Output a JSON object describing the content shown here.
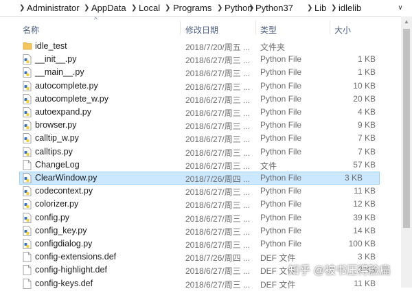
{
  "address_bar": {
    "crumbs": [
      "Administrator",
      "AppData",
      "Local",
      "Programs",
      "Python",
      "Python37",
      "Lib",
      "idlelib"
    ],
    "separator": "❯",
    "dropdown_glyph": "∨"
  },
  "columns": {
    "name": "名称",
    "date": "修改日期",
    "type": "类型",
    "size": "大小",
    "sort_glyph": "^"
  },
  "files": [
    {
      "name": "idle_test",
      "date": "2018/7/20/周五 ...",
      "type": "文件夹",
      "size": "",
      "icon": "folder-icon"
    },
    {
      "name": "__init__.py",
      "date": "2018/6/27/周三 ...",
      "type": "Python File",
      "size": "1 KB",
      "icon": "python-file-icon"
    },
    {
      "name": "__main__.py",
      "date": "2018/6/27/周三 ...",
      "type": "Python File",
      "size": "1 KB",
      "icon": "python-file-icon"
    },
    {
      "name": "autocomplete.py",
      "date": "2018/6/27/周三 ...",
      "type": "Python File",
      "size": "10 KB",
      "icon": "python-file-icon"
    },
    {
      "name": "autocomplete_w.py",
      "date": "2018/6/27/周三 ...",
      "type": "Python File",
      "size": "20 KB",
      "icon": "python-file-icon"
    },
    {
      "name": "autoexpand.py",
      "date": "2018/6/27/周三 ...",
      "type": "Python File",
      "size": "4 KB",
      "icon": "python-file-icon"
    },
    {
      "name": "browser.py",
      "date": "2018/6/27/周三 ...",
      "type": "Python File",
      "size": "9 KB",
      "icon": "python-file-icon"
    },
    {
      "name": "calltip_w.py",
      "date": "2018/6/27/周三 ...",
      "type": "Python File",
      "size": "7 KB",
      "icon": "python-file-icon"
    },
    {
      "name": "calltips.py",
      "date": "2018/6/27/周三 ...",
      "type": "Python File",
      "size": "7 KB",
      "icon": "python-file-icon"
    },
    {
      "name": "ChangeLog",
      "date": "2018/6/27/周三 ...",
      "type": "文件",
      "size": "57 KB",
      "icon": "file-icon"
    },
    {
      "name": "ClearWindow.py",
      "date": "2018/7/26/周四 ...",
      "type": "Python File",
      "size": "3 KB",
      "icon": "python-file-icon",
      "selected": true
    },
    {
      "name": "codecontext.py",
      "date": "2018/6/27/周三 ...",
      "type": "Python File",
      "size": "11 KB",
      "icon": "python-file-icon"
    },
    {
      "name": "colorizer.py",
      "date": "2018/6/27/周三 ...",
      "type": "Python File",
      "size": "12 KB",
      "icon": "python-file-icon"
    },
    {
      "name": "config.py",
      "date": "2018/6/27/周三 ...",
      "type": "Python File",
      "size": "39 KB",
      "icon": "python-file-icon"
    },
    {
      "name": "config_key.py",
      "date": "2018/6/27/周三 ...",
      "type": "Python File",
      "size": "14 KB",
      "icon": "python-file-icon"
    },
    {
      "name": "configdialog.py",
      "date": "2018/6/27/周三 ...",
      "type": "Python File",
      "size": "100 KB",
      "icon": "python-file-icon"
    },
    {
      "name": "config-extensions.def",
      "date": "2018/7/26/周四 ...",
      "type": "DEF 文件",
      "size": "3 KB",
      "icon": "file-icon"
    },
    {
      "name": "config-highlight.def",
      "date": "2018/6/27/周三 ...",
      "type": "DEF 文件",
      "size": "3 KB",
      "icon": "file-icon"
    },
    {
      "name": "config-keys.def",
      "date": "2018/6/27/周三 ...",
      "type": "DEF 文件",
      "size": "11 KB",
      "icon": "file-icon"
    }
  ],
  "watermark": "知乎 @被书压得脸扁",
  "colors": {
    "selection_bg": "#cce8ff",
    "selection_border": "#99d1ff",
    "header_text": "#4d6082",
    "folder": "#f2c55c",
    "python_blue": "#3b72b5",
    "python_yellow": "#f5d23b"
  }
}
